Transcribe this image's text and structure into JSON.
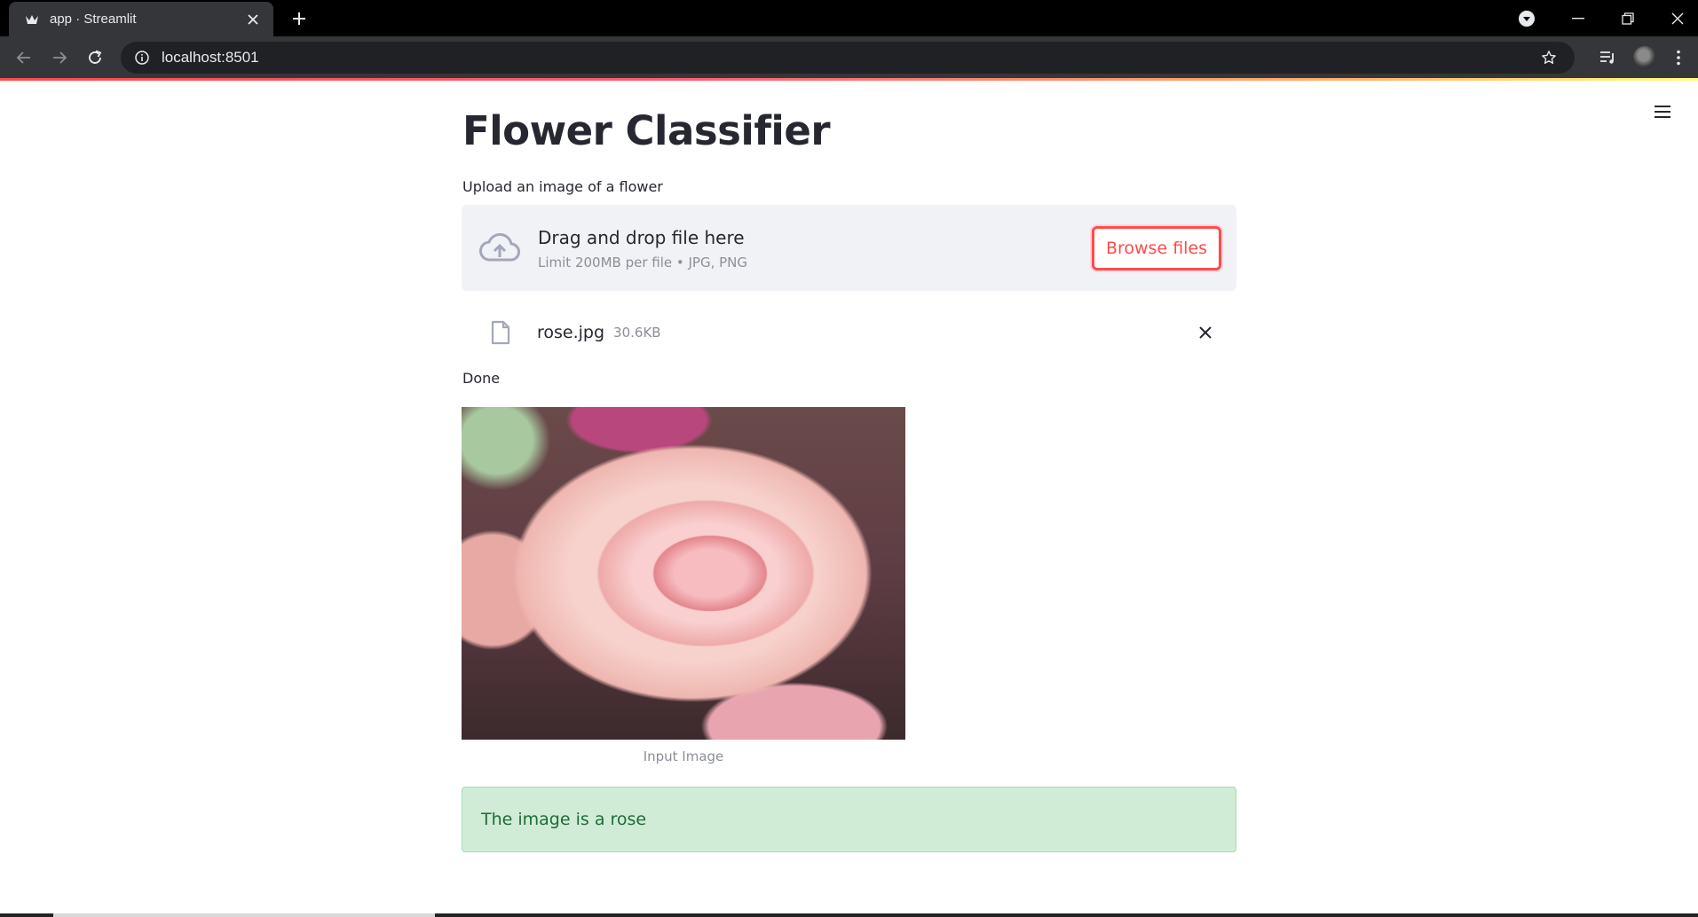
{
  "browser": {
    "tab_title": "app · Streamlit",
    "url": "localhost:8501"
  },
  "app": {
    "title": "Flower Classifier",
    "uploader": {
      "label": "Upload an image of a flower",
      "drop_text": "Drag and drop file here",
      "limit_text": "Limit 200MB per file • JPG, PNG",
      "browse_label": "Browse files"
    },
    "uploaded_file": {
      "name": "rose.jpg",
      "size": "30.6KB"
    },
    "status": "Done",
    "image_caption": "Input Image",
    "result": "The image is a rose"
  },
  "colors": {
    "accent": "#ff4b4b",
    "dropzone_bg": "#f0f2f6",
    "success_bg": "#d0ecd7",
    "success_text": "#1f6b36",
    "chrome_dark": "#35363a"
  },
  "icons": {
    "favicon": "streamlit-crown-icon",
    "upload": "cloud-upload-icon",
    "file": "file-icon",
    "remove": "close-icon",
    "menu": "hamburger-menu-icon"
  }
}
